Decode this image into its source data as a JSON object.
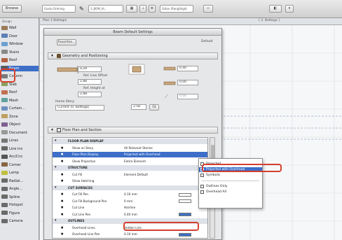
{
  "toolbar": {
    "browse_label": "Browse",
    "layer_field": "Gosta Ordning",
    "layer_combo": "3_BOM_ht...",
    "story_field": "Sidan (Rangfolgd)",
    "marquee_label": "Marquee"
  },
  "canvas": {
    "header": "Plan 1 Bottegio",
    "window_title": "[ 3. Bottega ]"
  },
  "palette": {
    "header": "Design",
    "items": [
      {
        "label": "Wall",
        "color": "#9b7a5a"
      },
      {
        "label": "Door",
        "color": "#5b7fb5"
      },
      {
        "label": "Window",
        "color": "#6aa0d0"
      },
      {
        "label": "Stairs",
        "color": "#8a8a8a"
      },
      {
        "label": "Roof",
        "color": "#b06040"
      },
      {
        "label": "Beam",
        "color": "#5a5a5a"
      },
      {
        "label": "Column",
        "color": "#7a7a7a"
      },
      {
        "label": "Slab",
        "color": "#8aa060"
      },
      {
        "label": "Roof",
        "color": "#c07050"
      },
      {
        "label": "Mesh",
        "color": "#60a0a0"
      },
      {
        "label": "Curtain...",
        "color": "#7090c0"
      },
      {
        "label": "Zone",
        "color": "#c0a060"
      },
      {
        "label": "Object",
        "color": "#806090"
      },
      {
        "label": "Document",
        "color": "#999999"
      },
      {
        "label": "Lines",
        "color": "#777777"
      },
      {
        "label": "Line ins",
        "color": "#666666"
      },
      {
        "label": "Arc/Circ",
        "color": "#555555"
      },
      {
        "label": "Corner",
        "color": "#886644"
      },
      {
        "label": "Lamp",
        "color": "#c0c040"
      },
      {
        "label": "Radial...",
        "color": "#6a6a6a"
      },
      {
        "label": "Angle...",
        "color": "#6a6a6a"
      },
      {
        "label": "Spline",
        "color": "#6a6a6a"
      },
      {
        "label": "Hotspot",
        "color": "#6a6a6a"
      },
      {
        "label": "Figure",
        "color": "#6a6a6a"
      },
      {
        "label": "Camera",
        "color": "#6a6a6a"
      }
    ],
    "selected_index": 5
  },
  "dialog": {
    "title": "Beam Default Settings",
    "favorites_label": "Favorites...",
    "default_label": "Default",
    "geometry": {
      "section_title": "Geometry and Positioning",
      "height_value": "0.29",
      "ref_line_label": "Ref. Line Offset",
      "ref_offset_value": "2.88",
      "ref_ref_label": "Ref. Height at",
      "ref_height_value": "2.88",
      "width_value": "0.40",
      "depth_value": "0.00",
      "slant_value": "0.00",
      "bottom_value": "2.58",
      "home_story_label": "Home Story:",
      "home_story_value": "Current (0. Bottega)",
      "fit_label": "Fit"
    },
    "floor_plan": {
      "section_title": "Floor Plan and Section",
      "rows": [
        {
          "kind": "cat",
          "name": "FLOOR PLAN DISPLAY",
          "value": "",
          "swatch": ""
        },
        {
          "kind": "row",
          "name": "Show on Story",
          "value": "All Relevant Stories",
          "swatch": ""
        },
        {
          "kind": "sel",
          "name": "Floor Plan Display",
          "value": "Projected with Overhead",
          "swatch": ""
        },
        {
          "kind": "row",
          "name": "Show Projection",
          "value": "Entire Element",
          "swatch": ""
        },
        {
          "kind": "cat",
          "name": "STRUCTURE",
          "value": "",
          "swatch": ""
        },
        {
          "kind": "row",
          "name": "Cut Fill",
          "value": "Element Default",
          "swatch": ""
        },
        {
          "kind": "row",
          "name": "Show Hatching",
          "value": "",
          "swatch": ""
        },
        {
          "kind": "cat",
          "name": "CUT SURFACES",
          "value": "",
          "swatch": ""
        },
        {
          "kind": "row",
          "name": "Cut Fill Pen",
          "value": "0.10 mm",
          "swatch": "#ffffff"
        },
        {
          "kind": "row",
          "name": "Cut Fill Background Pen",
          "value": "0 mm",
          "swatch": "#ffffff"
        },
        {
          "kind": "row",
          "name": "Cut Line",
          "value": "Hairline",
          "swatch": ""
        },
        {
          "kind": "row",
          "name": "Cut Line Pen",
          "value": "0.40 mm",
          "swatch": "#3d6fc8"
        },
        {
          "kind": "cat",
          "name": "OUTLINES",
          "value": "",
          "swatch": ""
        },
        {
          "kind": "row",
          "name": "Overhead Lines",
          "value": "Hidden Line",
          "swatch": ""
        },
        {
          "kind": "row",
          "name": "Overhead Line Pen",
          "value": "0.10 mm",
          "swatch": "#3d6fc8"
        }
      ]
    }
  },
  "popup": {
    "items": [
      "Projected",
      "Projected with Overhead",
      "Symbolic",
      "",
      "Outlines Only",
      "Overhead All"
    ],
    "selected_index": 1
  }
}
